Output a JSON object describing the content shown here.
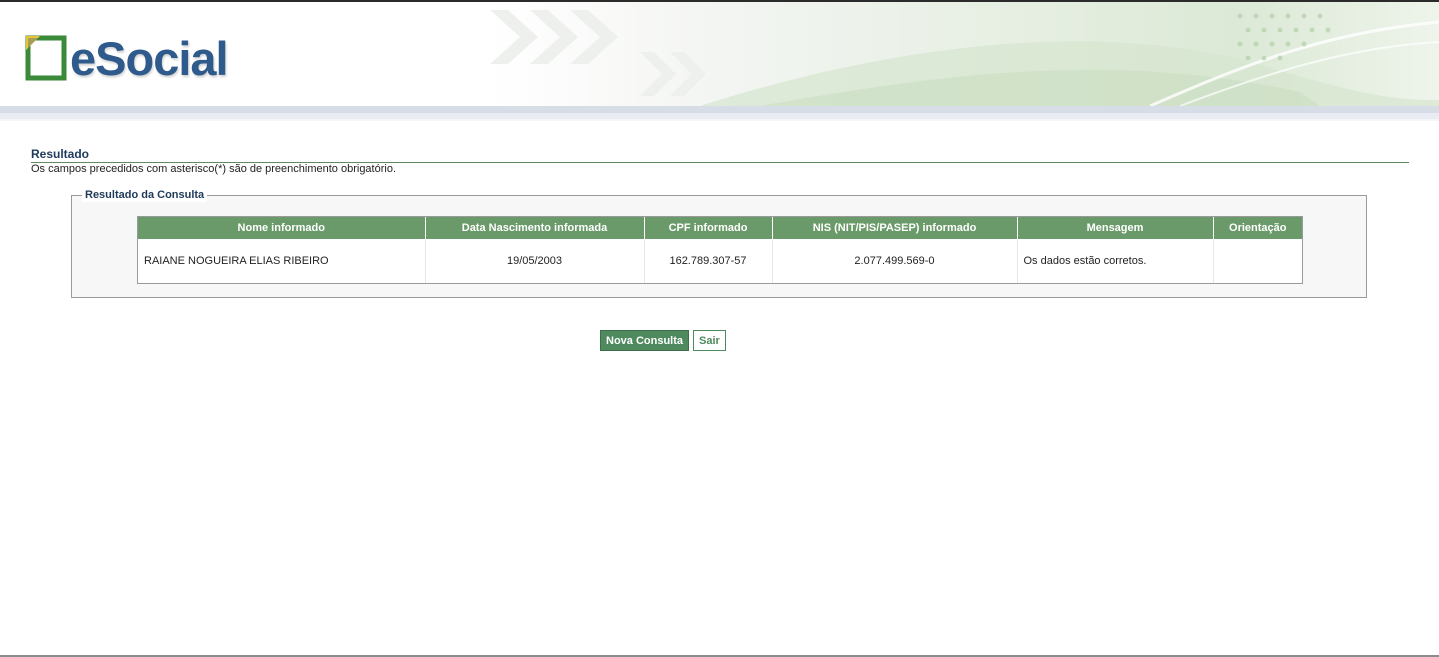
{
  "header": {
    "logo_text": "eSocial"
  },
  "section": {
    "title": "Resultado",
    "note": "Os campos precedidos com asterisco(*) são de preenchimento obrigatório."
  },
  "result": {
    "legend": "Resultado da Consulta",
    "columns": [
      "Nome informado",
      "Data Nascimento informada",
      "CPF informado",
      "NIS (NIT/PIS/PASEP) informado",
      "Mensagem",
      "Orientação"
    ],
    "rows": [
      {
        "nome": "RAIANE NOGUEIRA ELIAS RIBEIRO",
        "data_nascimento": "19/05/2003",
        "cpf": "162.789.307-57",
        "nis": "2.077.499.569-0",
        "mensagem": "Os dados estão corretos.",
        "orientacao": ""
      }
    ]
  },
  "actions": {
    "nova_consulta": "Nova Consulta",
    "sair": "Sair"
  },
  "colors": {
    "header_green": "#6a9a6a",
    "button_green": "#4f8a5f",
    "logo_blue": "#2f5a8c",
    "title_blue": "#1e3a5a"
  }
}
